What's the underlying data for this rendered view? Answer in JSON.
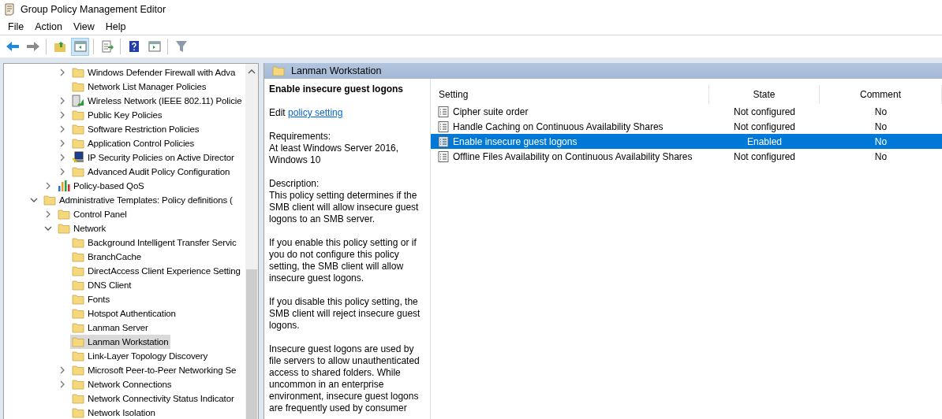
{
  "window": {
    "title": "Group Policy Management Editor"
  },
  "menu": [
    "File",
    "Action",
    "View",
    "Help"
  ],
  "toolbar": [
    {
      "kind": "back",
      "pressed": false
    },
    {
      "kind": "forward",
      "pressed": false
    },
    {
      "kind": "sep"
    },
    {
      "kind": "up",
      "pressed": false
    },
    {
      "kind": "tree",
      "pressed": true
    },
    {
      "kind": "sep"
    },
    {
      "kind": "export",
      "pressed": false
    },
    {
      "kind": "sep"
    },
    {
      "kind": "help",
      "pressed": false
    },
    {
      "kind": "pane",
      "pressed": false
    },
    {
      "kind": "sep"
    },
    {
      "kind": "filter",
      "pressed": false
    }
  ],
  "tree": [
    {
      "children": [
        {
          "children": [
            {
              "label": "Windows Defender Firewall with Adva",
              "kind": "folder",
              "expanded": false,
              "selected": false
            },
            {
              "label": "Network List Manager Policies",
              "kind": "folder",
              "selected": false
            },
            {
              "label": "Wireless Network (IEEE 802.11) Policie",
              "kind": "wireless",
              "expanded": false,
              "selected": false
            },
            {
              "label": "Public Key Policies",
              "kind": "folder",
              "expanded": false,
              "selected": false
            },
            {
              "label": "Software Restriction Policies",
              "kind": "folder",
              "expanded": false,
              "selected": false
            },
            {
              "label": "Application Control Policies",
              "kind": "folder",
              "expanded": false,
              "selected": false
            },
            {
              "label": "IP Security Policies on Active Director",
              "kind": "ipsec",
              "expanded": false,
              "selected": false
            },
            {
              "label": "Advanced Audit Policy Configuration",
              "kind": "folder",
              "expanded": false,
              "selected": false
            }
          ]
        },
        {
          "label": "Policy-based QoS",
          "kind": "qos",
          "expanded": false,
          "selected": false
        }
      ]
    },
    {
      "label": "Administrative Templates: Policy definitions (",
      "kind": "folder",
      "expanded": true,
      "selected": false,
      "children": [
        {
          "label": "Control Panel",
          "kind": "folder",
          "expanded": false,
          "selected": false
        },
        {
          "label": "Network",
          "kind": "folder",
          "expanded": true,
          "selected": false,
          "children": [
            {
              "label": "Background Intelligent Transfer Servic",
              "kind": "folder",
              "selected": false
            },
            {
              "label": "BranchCache",
              "kind": "folder",
              "selected": false
            },
            {
              "label": "DirectAccess Client Experience Setting",
              "kind": "folder",
              "selected": false
            },
            {
              "label": "DNS Client",
              "kind": "folder",
              "selected": false
            },
            {
              "label": "Fonts",
              "kind": "folder",
              "selected": false
            },
            {
              "label": "Hotspot Authentication",
              "kind": "folder",
              "selected": false
            },
            {
              "label": "Lanman Server",
              "kind": "folder",
              "selected": false
            },
            {
              "label": "Lanman Workstation",
              "kind": "folder",
              "selected": true
            },
            {
              "label": "Link-Layer Topology Discovery",
              "kind": "folder",
              "selected": false
            },
            {
              "label": "Microsoft Peer-to-Peer Networking Se",
              "kind": "folder",
              "expanded": false,
              "selected": false
            },
            {
              "label": "Network Connections",
              "kind": "folder",
              "expanded": false,
              "selected": false
            },
            {
              "label": "Network Connectivity Status Indicator",
              "kind": "folder",
              "selected": false
            },
            {
              "label": "Network Isolation",
              "kind": "folder",
              "selected": false
            }
          ]
        }
      ]
    }
  ],
  "details": {
    "header": "Lanman Workstation",
    "title": "Enable insecure guest logons",
    "edit_prefix": "Edit",
    "edit_link": "policy setting",
    "paragraphs": [
      "Requirements:\nAt least Windows Server 2016, Windows 10",
      "Description:\nThis policy setting determines if the SMB client will allow insecure guest logons to an SMB server.",
      "If you enable this policy setting or if you do not configure this policy setting, the SMB client will allow insecure guest logons.",
      "If you disable this policy setting, the SMB client will reject insecure guest logons.",
      "Insecure guest logons are used by file servers to allow unauthenticated access to shared folders. While uncommon in an enterprise environment, insecure guest logons are frequently used by consumer"
    ]
  },
  "table": {
    "columns": [
      "Setting",
      "State",
      "Comment"
    ],
    "rows": [
      {
        "setting": "Cipher suite order",
        "state": "Not configured",
        "comment": "No",
        "selected": false
      },
      {
        "setting": "Handle Caching on Continuous Availability Shares",
        "state": "Not configured",
        "comment": "No",
        "selected": false
      },
      {
        "setting": "Enable insecure guest logons",
        "state": "Enabled",
        "comment": "No",
        "selected": true
      },
      {
        "setting": "Offline Files Availability on Continuous Availability Shares",
        "state": "Not configured",
        "comment": "No",
        "selected": false
      }
    ]
  }
}
